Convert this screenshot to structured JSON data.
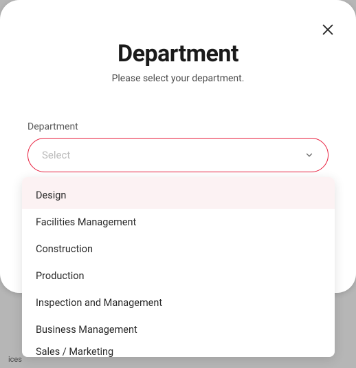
{
  "modal": {
    "title": "Department",
    "subtitle": "Please select your department.",
    "fieldLabel": "Department"
  },
  "select": {
    "placeholder": "Select"
  },
  "dropdown": {
    "items": [
      "Design",
      "Facilities Management",
      "Construction",
      "Production",
      "Inspection and Management",
      "Business Management",
      "Sales / Marketing"
    ],
    "highlightedIndex": 0
  },
  "backgroundText": "ices"
}
